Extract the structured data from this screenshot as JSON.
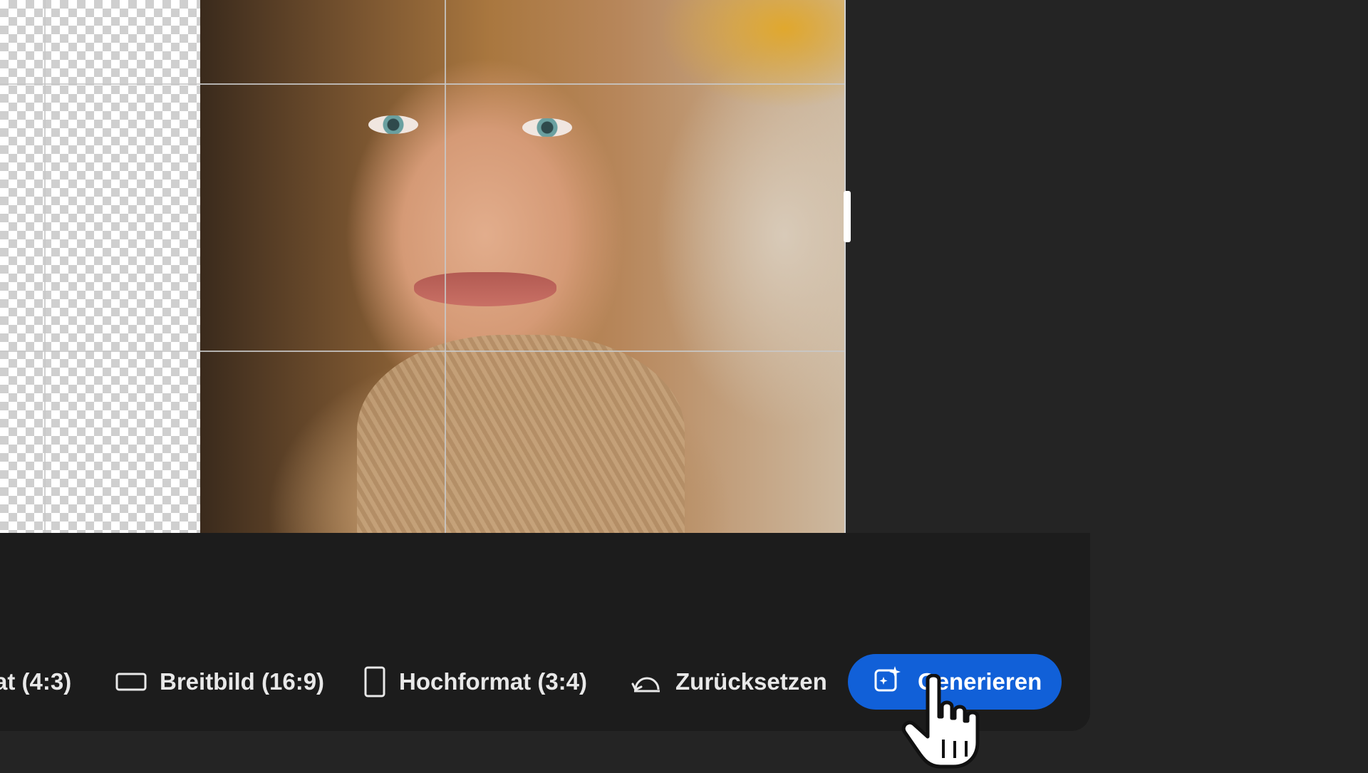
{
  "toolbar": {
    "items": [
      {
        "id": "landscape",
        "label": "at (4:3)",
        "icon": "landscape-icon"
      },
      {
        "id": "widescreen",
        "label": "Breitbild (16:9)",
        "icon": "widescreen-icon"
      },
      {
        "id": "portrait",
        "label": "Hochformat (3:4)",
        "icon": "portrait-icon"
      },
      {
        "id": "reset",
        "label": "Zurücksetzen",
        "icon": "undo-icon"
      }
    ],
    "generate": {
      "label": "Generieren",
      "icon": "generative-expand-icon"
    }
  },
  "colors": {
    "accent": "#1160d8",
    "background": "#242424",
    "taskbar": "#1c1c1c",
    "text": "#e8e8e8"
  },
  "cursor": {
    "type": "hand-pointer-icon"
  }
}
